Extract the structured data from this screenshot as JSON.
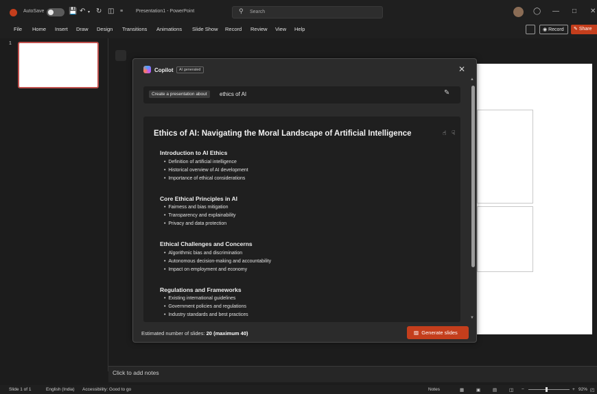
{
  "titlebar": {
    "autosave_label": "AutoSave",
    "title": "Presentation1 - PowerPoint",
    "search_placeholder": "Search"
  },
  "menu": [
    "File",
    "Home",
    "Insert",
    "Draw",
    "Design",
    "Transitions",
    "Animations",
    "Slide Show",
    "Record",
    "Review",
    "View",
    "Help"
  ],
  "ribbon_buttons": {
    "record": "Record",
    "share": "Share"
  },
  "slides_pane": {
    "current_number": "1"
  },
  "notes": {
    "placeholder": "Click to add notes"
  },
  "status": {
    "slide": "Slide 1 of 1",
    "language": "English (India)",
    "accessibility": "Accessibility: Good to go",
    "notes": "Notes",
    "zoom": "92%"
  },
  "copilot": {
    "title": "Copilot",
    "badge": "AI generated",
    "prompt_chip": "Create a presentation about",
    "prompt_value": "ethics of AI",
    "outline_title": "Ethics of AI: Navigating the Moral Landscape of Artificial Intelligence",
    "sections": [
      {
        "heading": "Introduction to AI Ethics",
        "bullets": [
          "Definition of artificial intelligence",
          "Historical overview of AI development",
          "Importance of ethical considerations"
        ]
      },
      {
        "heading": "Core Ethical Principles in AI",
        "bullets": [
          "Fairness and bias mitigation",
          "Transparency and explainability",
          "Privacy and data protection"
        ]
      },
      {
        "heading": "Ethical Challenges and Concerns",
        "bullets": [
          "Algorithmic bias and discrimination",
          "Autonomous decision-making and accountability",
          "Impact on employment and economy"
        ]
      },
      {
        "heading": "Regulations and Frameworks",
        "bullets": [
          "Existing international guidelines",
          "Government policies and regulations",
          "Industry standards and best practices"
        ]
      }
    ],
    "estimate_label": "Estimated number of slides:",
    "estimate_value": "20 (maximum 40)",
    "generate_label": "Generate slides"
  },
  "colors": {
    "accent": "#c43e1c",
    "dialog_bg": "#2b2b2b",
    "panel_bg": "#1f1f1f"
  }
}
